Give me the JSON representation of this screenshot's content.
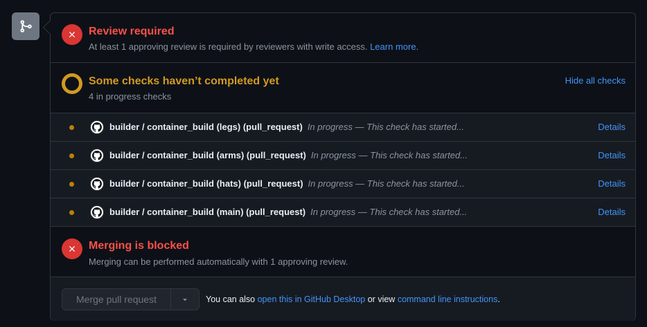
{
  "review": {
    "title": "Review required",
    "subtitle": "At least 1 approving review is required by reviewers with write access.",
    "link": "Learn more."
  },
  "checks": {
    "title": "Some checks haven’t completed yet",
    "subtitle": "4 in progress checks",
    "toggle_label": "Hide all checks",
    "items": [
      {
        "name": "builder / container_build (legs) (pull_request)",
        "status": "In progress — This check has started...",
        "details": "Details"
      },
      {
        "name": "builder / container_build (arms) (pull_request)",
        "status": "In progress — This check has started...",
        "details": "Details"
      },
      {
        "name": "builder / container_build (hats) (pull_request)",
        "status": "In progress — This check has started...",
        "details": "Details"
      },
      {
        "name": "builder / container_build (main) (pull_request)",
        "status": "In progress — This check has started...",
        "details": "Details"
      }
    ]
  },
  "merge_block": {
    "title": "Merging is blocked",
    "subtitle": "Merging can be performed automatically with 1 approving review."
  },
  "footer": {
    "merge_button": "Merge pull request",
    "text_prefix": "You can also",
    "desktop_link": "open this in GitHub Desktop",
    "text_middle": "or view",
    "cli_link": "command line instructions",
    "text_suffix": "."
  },
  "colors": {
    "error": "#f85149",
    "pending": "#d29922",
    "link": "#4493f8",
    "background": "#0d1117"
  },
  "icons": {
    "timeline": "git-merge-icon",
    "error": "x-icon",
    "pending": "pending-ring-icon",
    "check_avatar": "github-mark-icon",
    "dropdown": "triangle-down-icon"
  }
}
